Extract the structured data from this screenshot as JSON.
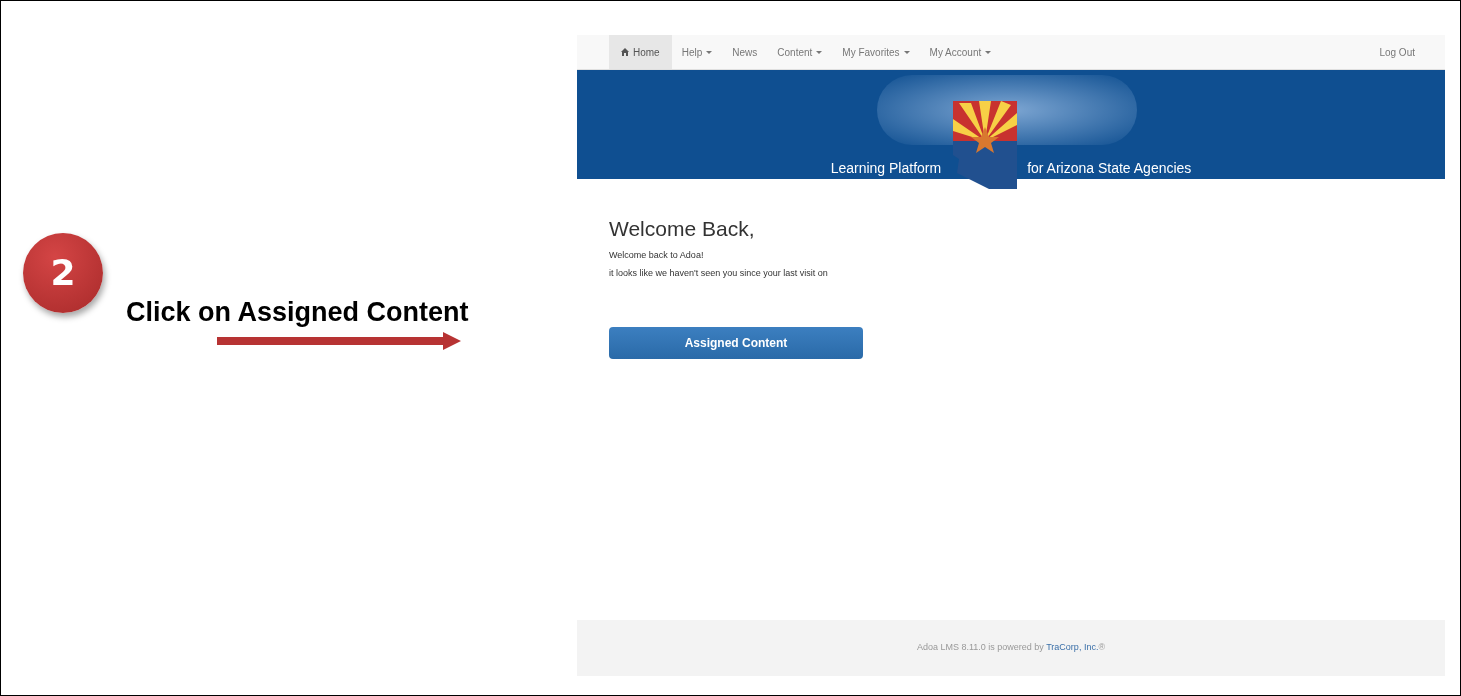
{
  "callout": {
    "step": "2",
    "instruction": "Click on Assigned Content"
  },
  "navbar": {
    "items": [
      {
        "label": "Home",
        "kind": "icon_link",
        "selected": true
      },
      {
        "label": "Help",
        "kind": "dropdown",
        "selected": false
      },
      {
        "label": "News",
        "kind": "link",
        "selected": false
      },
      {
        "label": "Content",
        "kind": "dropdown",
        "selected": false
      },
      {
        "label": "My Favorites",
        "kind": "dropdown",
        "selected": false
      },
      {
        "label": "My Account",
        "kind": "dropdown",
        "selected": false
      }
    ],
    "logout": "Log Out"
  },
  "banner": {
    "left_text": "Learning Platform",
    "right_text": "for Arizona State Agencies"
  },
  "welcome": {
    "heading": "Welcome Back,",
    "lines": [
      "Welcome back to Adoa!",
      "it looks like we haven't seen you since your last visit on"
    ],
    "button": "Assigned Content"
  },
  "footer": {
    "text": "Adoa LMS 8.11.0 is powered by ",
    "link": "TraCorp, Inc.",
    "suffix": "®"
  }
}
